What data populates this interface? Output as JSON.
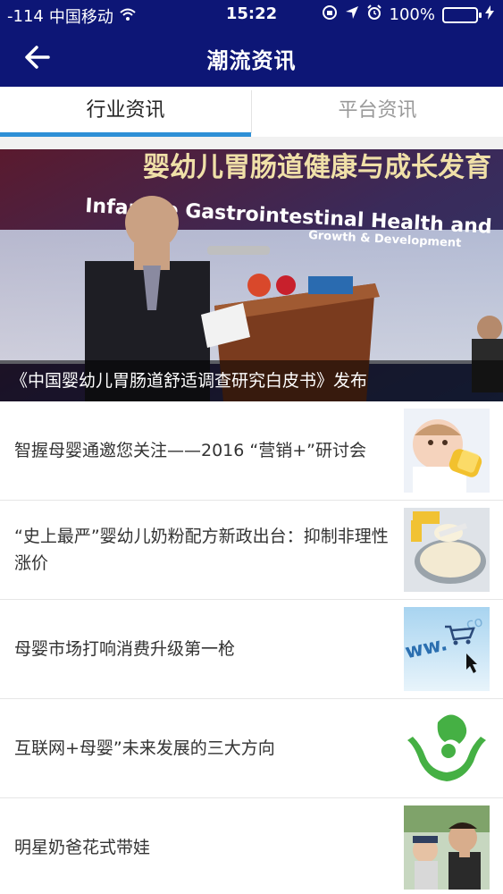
{
  "status_bar": {
    "signal": "-114",
    "carrier": "中国移动",
    "time": "15:22",
    "battery_percent": "100%",
    "battery_level": 1.0
  },
  "nav": {
    "title": "潮流资讯"
  },
  "tabs": [
    {
      "label": "行业资讯",
      "active": true
    },
    {
      "label": "平台资讯",
      "active": false
    }
  ],
  "featured": {
    "banner_cn": "婴幼儿胃肠道健康与成长发育",
    "banner_en_1": "Infantile Gastrointestinal Health and",
    "banner_en_2": "Growth & Development",
    "caption": "《中国婴幼儿胃肠道舒适调查研究白皮书》发布"
  },
  "news": [
    {
      "title": "智握母婴通邀您关注——2016 “营销+”研讨会",
      "thumb": "baby-bottle-image"
    },
    {
      "title": "“史上最严”婴幼儿奶粉配方新政出台：抑制非理性涨价",
      "thumb": "milk-powder-image"
    },
    {
      "title": "母婴市场打响消费升级第一枪",
      "thumb": "ecommerce-cart-image"
    },
    {
      "title": "互联网+母婴”未来发展的三大方向",
      "thumb": "mother-child-hands-logo"
    },
    {
      "title": "明星奶爸花式带娃",
      "thumb": "celebrity-dad-photo"
    }
  ],
  "colors": {
    "header_bg": "#0d1676",
    "tab_active_underline": "#2e8fd6",
    "tab_inactive_text": "#999999"
  }
}
